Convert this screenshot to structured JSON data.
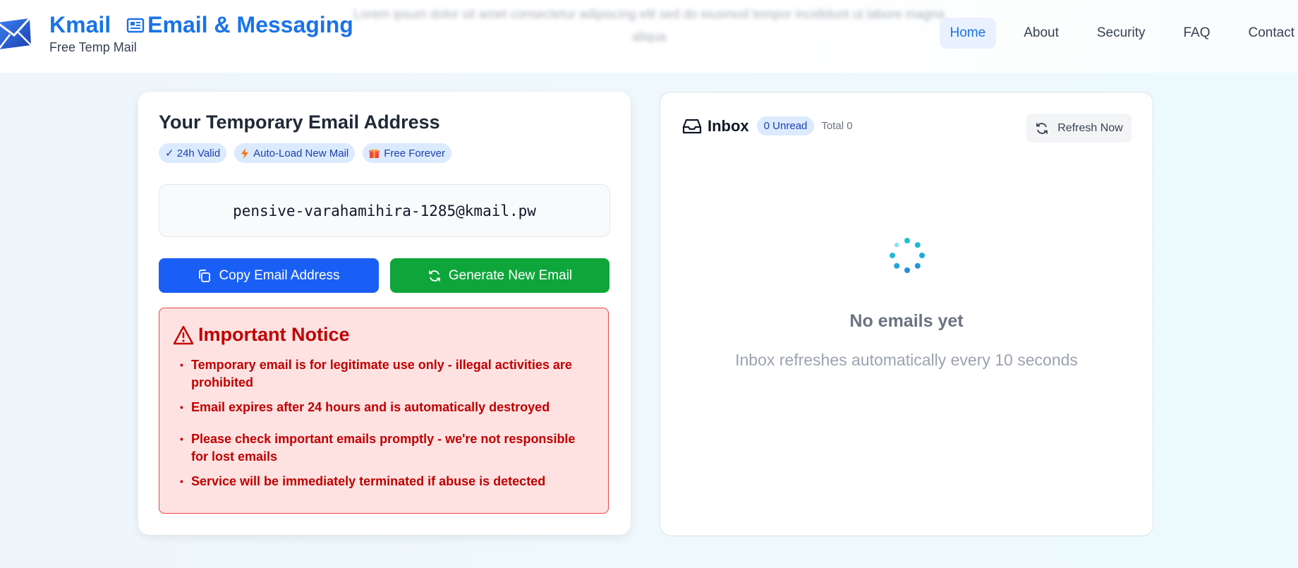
{
  "header": {
    "brand_name": "Kmail",
    "tagline": "Email & Messaging",
    "subtitle": "Free Temp Mail",
    "blurred_text": "Lorem ipsum dolor sit amet consectetur adipiscing elit sed do eiusmod tempor incididunt ut labore magna aliqua",
    "nav": [
      {
        "label": "Home",
        "active": true
      },
      {
        "label": "About",
        "active": false
      },
      {
        "label": "Security",
        "active": false
      },
      {
        "label": "FAQ",
        "active": false
      },
      {
        "label": "Contact",
        "active": false
      }
    ]
  },
  "generator": {
    "title": "Your Temporary Email Address",
    "badges": [
      {
        "label": "✓ 24h Valid",
        "icon": "none"
      },
      {
        "label": "Auto-Load New Mail",
        "icon": "lightning-icon"
      },
      {
        "label": "Free Forever",
        "icon": "gift-icon"
      }
    ],
    "email_address": "pensive-varahamihira-1285@kmail.pw",
    "copy_label": "Copy Email Address",
    "generate_label": "Generate New Email"
  },
  "notice": {
    "title": "Important Notice",
    "items": [
      "Temporary email is for legitimate use only - illegal activities are prohibited",
      "Email expires after 24 hours and is automatically destroyed",
      "Please check important emails promptly - we're not responsible for lost emails",
      "Service will be immediately terminated if abuse is detected"
    ]
  },
  "inbox": {
    "title": "Inbox",
    "unread": "0 Unread",
    "total": "Total 0",
    "refresh_label": "Refresh Now",
    "empty_title": "No emails yet",
    "empty_subtitle": "Inbox refreshes automatically every 10 seconds"
  },
  "colors": {
    "brand": "#1a73e8",
    "copy_button": "#1a5ff5",
    "generate_button": "#0ea63a",
    "notice_red": "#c00000",
    "notice_bg": "#fee2e2"
  }
}
